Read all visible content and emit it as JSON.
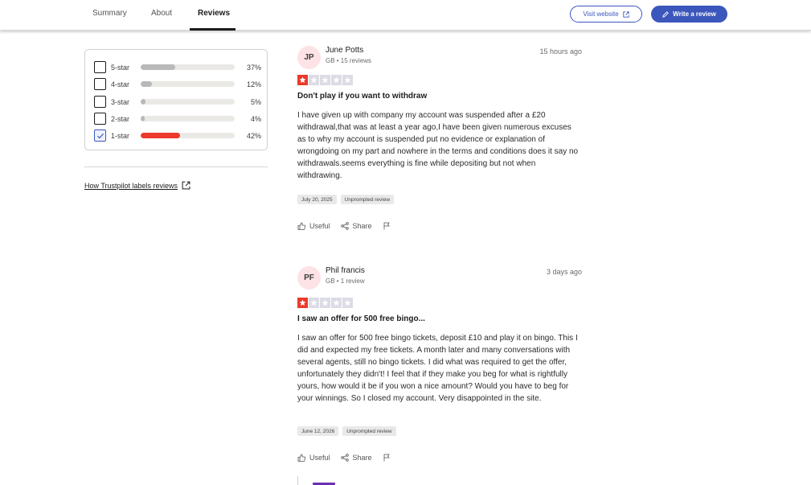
{
  "nav": {
    "tabs": [
      {
        "label": "Summary"
      },
      {
        "label": "About"
      },
      {
        "label": "Reviews"
      }
    ],
    "visit_label": "Visit website",
    "write_label": "Write a review",
    "accent_color": "#3c57bc"
  },
  "filter": {
    "rows": [
      {
        "label": "5-star",
        "percent": "37%",
        "fill_fraction": 0.37,
        "checked": false
      },
      {
        "label": "4-star",
        "percent": "12%",
        "fill_fraction": 0.12,
        "checked": false
      },
      {
        "label": "3-star",
        "percent": "5%",
        "fill_fraction": 0.05,
        "checked": false
      },
      {
        "label": "2-star",
        "percent": "4%",
        "fill_fraction": 0.04,
        "checked": false
      },
      {
        "label": "1-star",
        "percent": "42%",
        "fill_fraction": 0.42,
        "checked": true
      }
    ],
    "labels_link": "How Trustpilot labels reviews",
    "active_bar_color": "#eb3a2b"
  },
  "reviews": [
    {
      "initials": "JP",
      "author": "June Potts",
      "meta": "GB • 15 reviews",
      "time": "15 hours ago",
      "rating": 1,
      "title": "Don't play if you want to withdraw",
      "body": "I have given up with company my account was suspended after a £20 withdrawal,that was at least a year ago,I have been given numerous excuses as to why my account is suspended put no evidence or explanation of wrongdoing on my part and nowhere in the terms and conditions does it say no withdrawals.seems everything is fine while depositing but not when withdrawing.",
      "date_tag": "July 20, 2025",
      "source_tag": "Unprompted review",
      "useful_label": "Useful",
      "share_label": "Share"
    },
    {
      "initials": "PF",
      "author": "Phil francis",
      "meta": "GB • 1 review",
      "time": "3 days ago",
      "rating": 1,
      "title": "I saw an offer for 500 free bingo...",
      "body": "I saw an offer for 500 free bingo tickets, deposit £10 and play it on bingo. This I did and expected my free tickets. A month later and many conversations with several agents, still no bingo tickets. I did what was required to get the offer, unfortunately they didn't! I feel that if they make you beg for what is rightfully yours, how would it be if you won a nice amount? Would you have to beg for your winnings. So I closed my account. Very disappointed in the site.",
      "date_tag": "June 12, 2026",
      "source_tag": "Unprompted review",
      "useful_label": "Useful",
      "share_label": "Share"
    }
  ]
}
